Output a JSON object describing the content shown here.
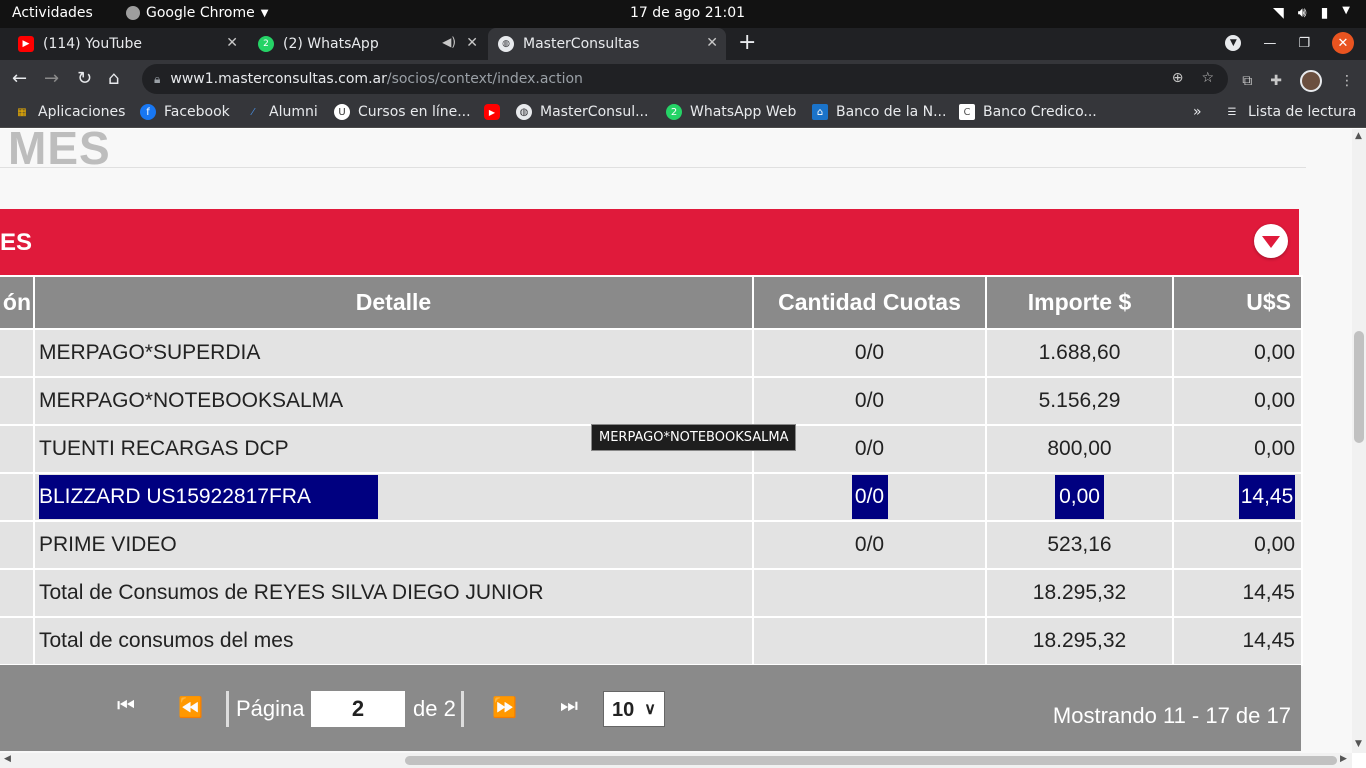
{
  "system_bar": {
    "activities": "Actividades",
    "app_name": "Google Chrome",
    "clock": "17 de ago  21:01"
  },
  "tabs": [
    {
      "title": "(114) YouTube",
      "icon": "youtube-icon"
    },
    {
      "title": "(2) WhatsApp",
      "icon": "whatsapp-icon"
    },
    {
      "title": "MasterConsultas",
      "icon": "globe-icon"
    }
  ],
  "address_bar": {
    "host": "www1.masterconsultas.com.ar",
    "path": "/socios/context/index.action"
  },
  "bookmarks": [
    {
      "label": "Aplicaciones",
      "icon": "apps-grid-icon"
    },
    {
      "label": "Facebook",
      "icon": "facebook-icon"
    },
    {
      "label": "Alumni",
      "icon": "alumni-icon"
    },
    {
      "label": "Cursos en líne...",
      "icon": "cursos-icon"
    },
    {
      "label": "",
      "icon": "youtube-icon"
    },
    {
      "label": "MasterConsul...",
      "icon": "globe-icon"
    },
    {
      "label": "WhatsApp Web",
      "icon": "whatsapp-icon"
    },
    {
      "label": "Banco de la N...",
      "icon": "bank-icon"
    },
    {
      "label": "Banco Credico...",
      "icon": "credicoop-icon"
    }
  ],
  "reading_list": "Lista de lectura",
  "page": {
    "heading": "MES",
    "section_title": "ES",
    "table": {
      "headers": [
        "ón",
        "Detalle",
        "Cantidad Cuotas",
        "Importe $",
        "U$S"
      ],
      "rows": [
        {
          "detalle": "MERPAGO*SUPERDIA",
          "cuotas": "0/0",
          "importe": "1.688,60",
          "usd": "0,00"
        },
        {
          "detalle": "MERPAGO*NOTEBOOKSALMA",
          "cuotas": "0/0",
          "importe": "5.156,29",
          "usd": "0,00"
        },
        {
          "detalle": "TUENTI RECARGAS DCP",
          "cuotas": "0/0",
          "importe": "800,00",
          "usd": "0,00"
        },
        {
          "detalle": "BLIZZARD US15922817FRA",
          "cuotas": "0/0",
          "importe": "0,00",
          "usd": "14,45"
        },
        {
          "detalle": "PRIME VIDEO",
          "cuotas": "0/0",
          "importe": "523,16",
          "usd": "0,00"
        },
        {
          "detalle": "Total de Consumos de REYES SILVA DIEGO JUNIOR",
          "cuotas": "",
          "importe": "18.295,32",
          "usd": "14,45"
        },
        {
          "detalle": "Total de consumos del mes",
          "cuotas": "",
          "importe": "18.295,32",
          "usd": "14,45"
        }
      ]
    },
    "tooltip": "MERPAGO*NOTEBOOKSALMA",
    "pager": {
      "page_label": "Página",
      "current_page": "2",
      "of_label": "de 2",
      "page_size": "10",
      "showing": "Mostrando 11 - 17 de 17"
    }
  },
  "colors": {
    "accent_red": "#e01a3b",
    "header_gray": "#8a8a8a",
    "selection_navy": "#000080"
  }
}
